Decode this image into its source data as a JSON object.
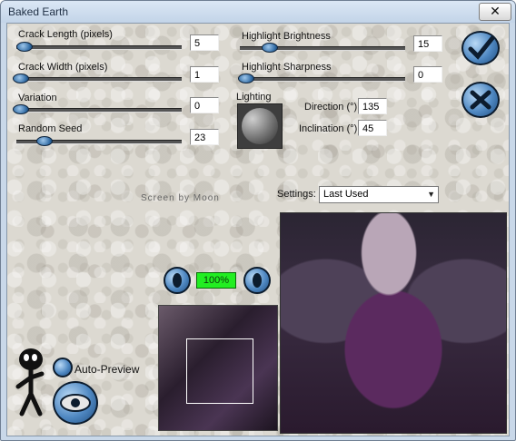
{
  "window": {
    "title": "Baked Earth",
    "close_glyph": "✕"
  },
  "sliders": [
    {
      "label": "Crack Length (pixels)",
      "value": "5",
      "fraction": 0.03
    },
    {
      "label": "Crack Width (pixels)",
      "value": "1",
      "fraction": 0.0
    },
    {
      "label": "Variation",
      "value": "0",
      "fraction": 0.0
    },
    {
      "label": "Random Seed",
      "value": "23",
      "fraction": 0.16
    },
    {
      "label": "Highlight Brightness",
      "value": "15",
      "fraction": 0.15
    },
    {
      "label": "Highlight Sharpness",
      "value": "0",
      "fraction": 0.0
    }
  ],
  "lighting": {
    "label": "Lighting",
    "direction_label": "Direction (°)",
    "direction_value": "135",
    "inclination_label": "Inclination (°)",
    "inclination_value": "45"
  },
  "settings": {
    "label": "Settings:",
    "selected": "Last Used"
  },
  "watermark": "Screen by Moon",
  "zoom": {
    "value": "100%"
  },
  "auto_preview": {
    "label": "Auto-Preview"
  },
  "icons": {
    "ok": "checkmark-icon",
    "cancel": "x-icon",
    "zoom_out": "zoom-out-icon",
    "zoom_in": "zoom-in-icon",
    "mascot": "stick-figure-icon",
    "eye": "eye-icon"
  },
  "colors": {
    "zoom_bg": "#22ee22",
    "button_blue": "#4f88c2"
  }
}
